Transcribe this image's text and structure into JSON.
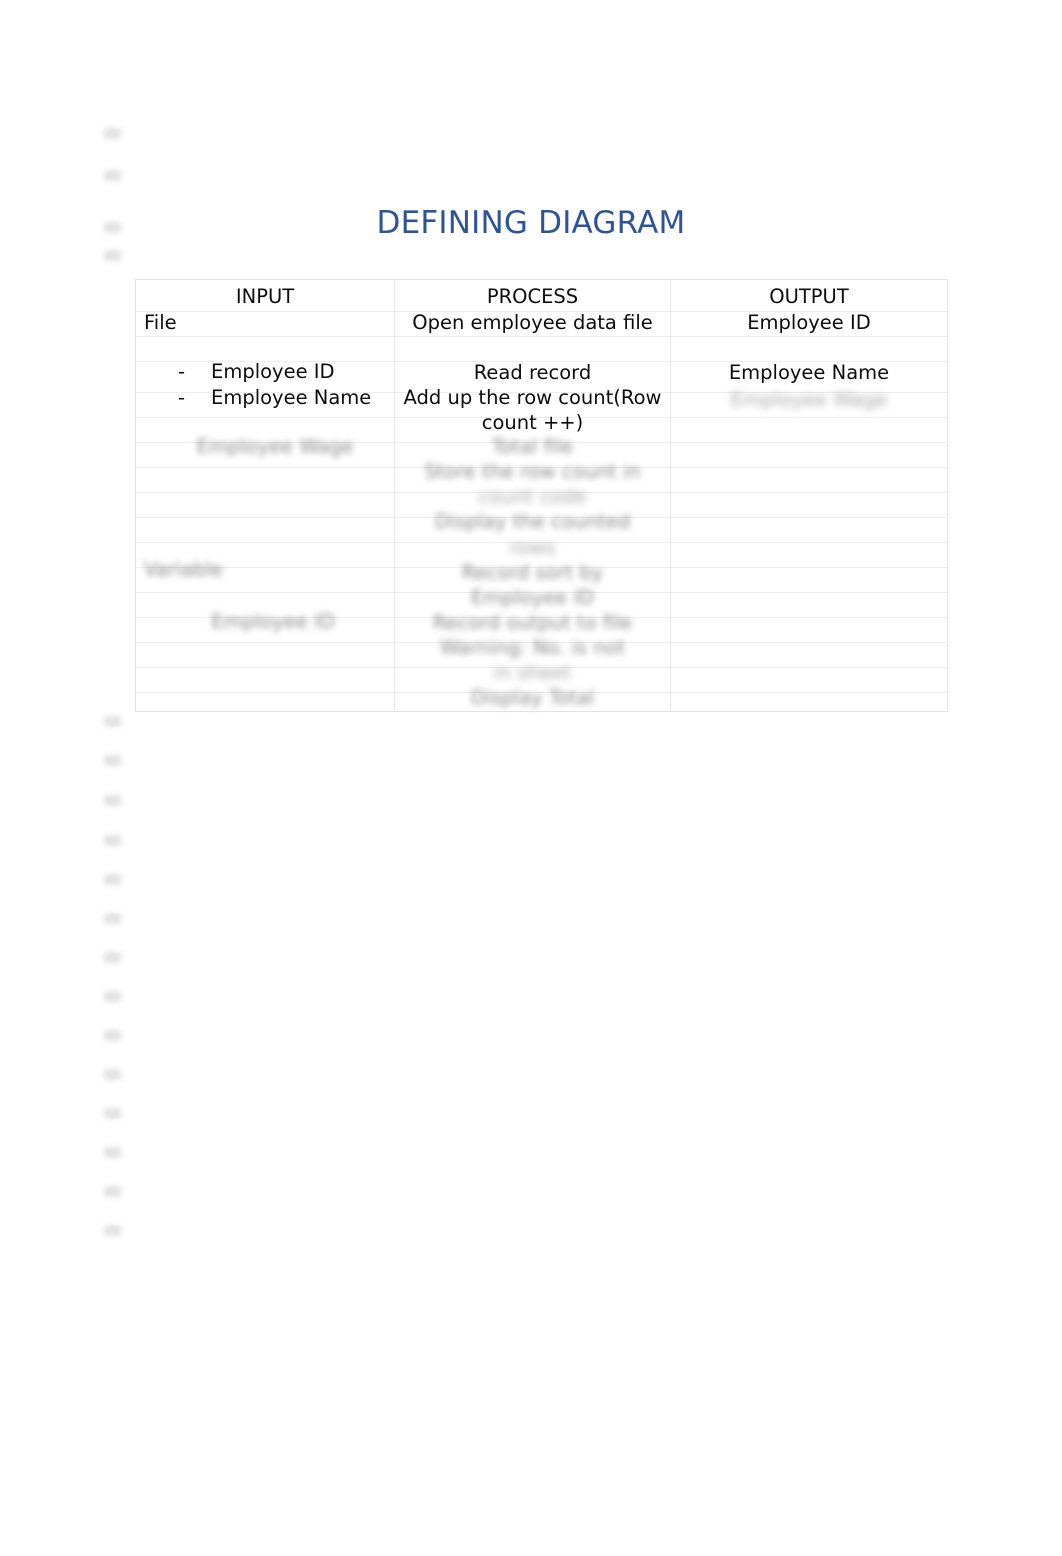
{
  "document": {
    "title": "DEFINING DIAGRAM",
    "title_color": "#2e5496",
    "background_color": "#ffffff"
  },
  "table": {
    "headers": {
      "input": "INPUT",
      "process": "PROCESS",
      "output": "OUTPUT"
    },
    "input_column": {
      "file_label": "File",
      "bullet_dash": "-",
      "bullets": [
        "Employee ID",
        "Employee Name"
      ],
      "redacted": [
        "Employee Wage",
        "Variable",
        "Employee ID"
      ]
    },
    "process_column": {
      "steps": [
        "Open employee data file",
        "Read record",
        "Add up the row count(Row count ++)"
      ],
      "redacted": [
        "Total file",
        "Store the row count in",
        "count code",
        "Display the counted",
        "rows",
        "Record sort by",
        "Employee ID",
        "Record output to file",
        "Warning: No. is not",
        "in sheet",
        "Display Total"
      ]
    },
    "output_column": {
      "items": [
        "Employee ID",
        "Employee Name"
      ],
      "redacted": [
        "Employee Wage"
      ]
    }
  },
  "margin_marks": {
    "count": 18,
    "color": "#d9d9d9"
  }
}
